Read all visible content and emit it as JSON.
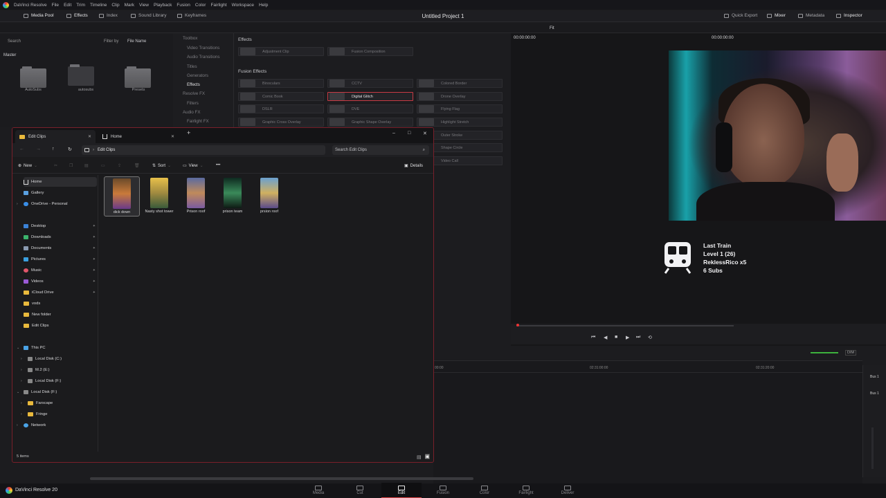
{
  "menubar": {
    "app": "DaVinci Resolve",
    "items": [
      "File",
      "Edit",
      "Trim",
      "Timeline",
      "Clip",
      "Mark",
      "View",
      "Playback",
      "Fusion",
      "Color",
      "Fairlight",
      "Workspace",
      "Help"
    ]
  },
  "tabbar": {
    "media_pool": "Media Pool",
    "effects": "Effects",
    "index": "Index",
    "sound_library": "Sound Library",
    "keyframes": "Keyframes",
    "quick_export": "Quick Export",
    "mixer": "Mixer",
    "metadata": "Metadata",
    "inspector": "Inspector"
  },
  "project_title": "Untitled Project 1",
  "mediapool": {
    "search": "Search",
    "filter_by": "Filter by",
    "filter_value": "File Name",
    "master": "Master",
    "folders": [
      "AutoSubs",
      "autosubs",
      "Presets"
    ]
  },
  "toolbox": {
    "items": [
      "Toolbox",
      "Video Transitions",
      "Audio Transitions",
      "Titles",
      "Generators",
      "Effects",
      "Resolve FX",
      "Filters",
      "Audio FX",
      "Fairlight FX"
    ],
    "selected": "Effects"
  },
  "effects_panel": {
    "header": "Effects",
    "top": [
      "Adjustment Clip",
      "Fusion Composition"
    ],
    "fusion_header": "Fusion Effects",
    "fusion": [
      "Binoculars",
      "CCTV",
      "Colored Border",
      "Comic Book",
      "Digital Glitch",
      "Drone Overlay",
      "DSLR",
      "DVE",
      "Flying Flag",
      "Graphic Cross Overlay",
      "Graphic Shape Overlay",
      "Highlight Stretch",
      "Outer Stroke",
      "Shape Circle",
      "Video Call"
    ],
    "selected": "Digital Glitch"
  },
  "viewer": {
    "timecode_left": "00:00:00:00",
    "fit": "Fit",
    "timecode_right": "00:00:00:00"
  },
  "overlay": {
    "lines": [
      "Last Train",
      "Level 1  (26)",
      "ReklessRico x5",
      "6 Subs"
    ]
  },
  "timeline": {
    "ruler": [
      "00:00",
      "02:31:00:00",
      "02:31:20:00"
    ],
    "dim": "DIM"
  },
  "mixer": {
    "bus1": "Bus 1",
    "bus1b": "Bus 1"
  },
  "bottom": {
    "brand": "DaVinci Resolve 20",
    "pages": [
      "Media",
      "Cut",
      "Edit",
      "Fusion",
      "Color",
      "Fairlight",
      "Deliver"
    ],
    "active": "Edit"
  },
  "explorer": {
    "tabs": [
      "Edit Clips",
      "Home"
    ],
    "address": "Edit Clips",
    "search_placeholder": "Search Edit Clips",
    "cmd": {
      "new": "New",
      "sort": "Sort",
      "view": "View",
      "more": "•••",
      "details": "Details"
    },
    "nav_top": [
      {
        "label": "Home",
        "sel": true
      },
      {
        "label": "Gallery"
      },
      {
        "label": "OneDrive - Personal"
      }
    ],
    "nav_quick": [
      "Desktop",
      "Downloads",
      "Documents",
      "Pictures",
      "Music",
      "Videos",
      "iCloud Drive",
      "vods",
      "New folder",
      "Edit Clips"
    ],
    "nav_pc": [
      "This PC",
      "Local Disk (C:)",
      "M.2 (E:)",
      "Local Disk (F:)",
      "Local Disk (F:)",
      "Farscape",
      "Fringe",
      "Network"
    ],
    "files": [
      "dick down",
      "Nasty shot tower",
      "Prison roof",
      "prison team",
      "prsion roof"
    ],
    "status": "5 items"
  },
  "colors": {
    "accent_red": "#c93a44",
    "folder_yellow": "#e9b93c"
  }
}
